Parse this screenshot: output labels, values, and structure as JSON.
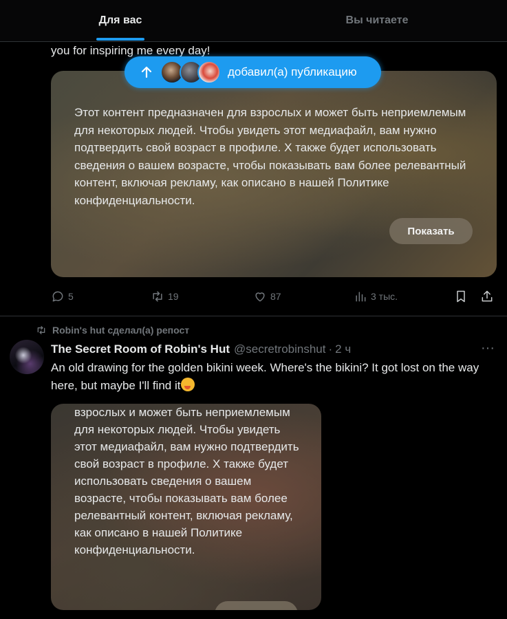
{
  "tabs": {
    "active": "Для вас",
    "inactive": "Вы читаете"
  },
  "post1": {
    "cut_text": "you for inspiring me every day!",
    "sensitive_notice": "Этот контент предназначен для взрослых и может быть неприемлемым для некоторых людей. Чтобы увидеть этот медиафайл, вам нужно подтвердить свой возраст в профиле. X также будет использовать сведения о вашем возрасте, чтобы показывать вам более релевантный контент, включая рекламу, как описано в нашей Политике конфиденциальности.",
    "show_button": "Показать",
    "actions": {
      "replies": "5",
      "reposts": "19",
      "likes": "87",
      "views": "3 тыс."
    }
  },
  "new_posts_pill": {
    "label": "добавил(а) публикацию",
    "icon": "arrow-up-icon"
  },
  "post2": {
    "repost_label": "Robin's hut сделал(а) репост",
    "display_name": "The Secret Room of Robin's Hut",
    "handle": "@secretrobinshut",
    "dot": "·",
    "time": "2 ч",
    "more": "···",
    "text": "An old drawing for the golden bikini week. Where's the bikini? It got lost on the way here, but maybe I'll find it",
    "sensitive_notice_partial": "взрослых и может быть неприемлемым для некоторых людей. Чтобы увидеть этот медиафайл, вам нужно подтвердить свой возраст в профиле. X также будет использовать сведения о вашем возрасте, чтобы показывать вам более релевантный контент, включая рекламу, как описано в нашей Политике конфиденциальности."
  },
  "colors": {
    "accent": "#1d9bf0",
    "muted": "#71767b",
    "text": "#e7e9ea",
    "border": "#2f3336"
  }
}
